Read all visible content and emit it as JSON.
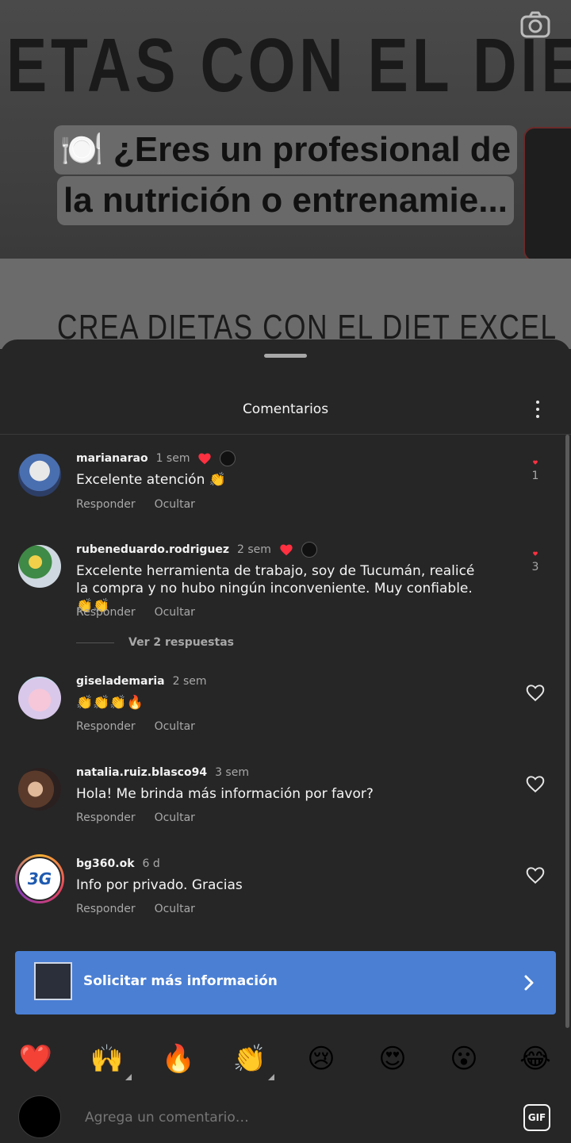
{
  "post": {
    "banner_text": "ETAS CON EL DIET E",
    "banner_sub": "CREA DIETAS CON EL DIET EXCEL",
    "caption_line1": "🍽️ ¿Eres un profesional de",
    "caption_line2": "la nutrición o entrenamie..."
  },
  "sheet": {
    "title": "Comentarios"
  },
  "comments": [
    {
      "user": "marianarao",
      "time": "1 sem",
      "text": "Excelente atención 👏",
      "reply": "Responder",
      "hide": "Ocultar",
      "likes": "1",
      "liked": true,
      "creator_liked": true
    },
    {
      "user": "rubeneduardo.rodriguez",
      "time": "2 sem",
      "text": "Excelente herramienta de trabajo, soy de Tucumán,  realicé la compra y no hubo ningún inconveniente. Muy confiable. 👏👏",
      "reply": "Responder",
      "hide": "Ocultar",
      "likes": "3",
      "liked": true,
      "creator_liked": true
    },
    {
      "user": "giselademaria",
      "time": "2 sem",
      "text": "👏👏👏🔥",
      "reply": "Responder",
      "hide": "Ocultar",
      "liked": false
    },
    {
      "user": "natalia.ruiz.blasco94",
      "time": "3 sem",
      "text": "Hola! Me brinda más información por favor?",
      "reply": "Responder",
      "hide": "Ocultar",
      "liked": false
    },
    {
      "user": "bg360.ok",
      "time": "6 d",
      "text": "Info por privado. Gracias",
      "reply": "Responder",
      "hide": "Ocultar",
      "liked": false
    }
  ],
  "view_replies": "Ver 2 respuestas",
  "cta": {
    "label": "Solicitar más información",
    "color": "#4a7fd4"
  },
  "emojis": [
    "❤️",
    "🙌",
    "🔥",
    "👏",
    "😢",
    "😍",
    "😮",
    "😂"
  ],
  "composer": {
    "placeholder": "Agrega un comentario…",
    "gif_label": "GIF"
  },
  "colors": {
    "background": "#262626",
    "heart_red": "#ff3040",
    "text_secondary": "#a8a8a8"
  }
}
